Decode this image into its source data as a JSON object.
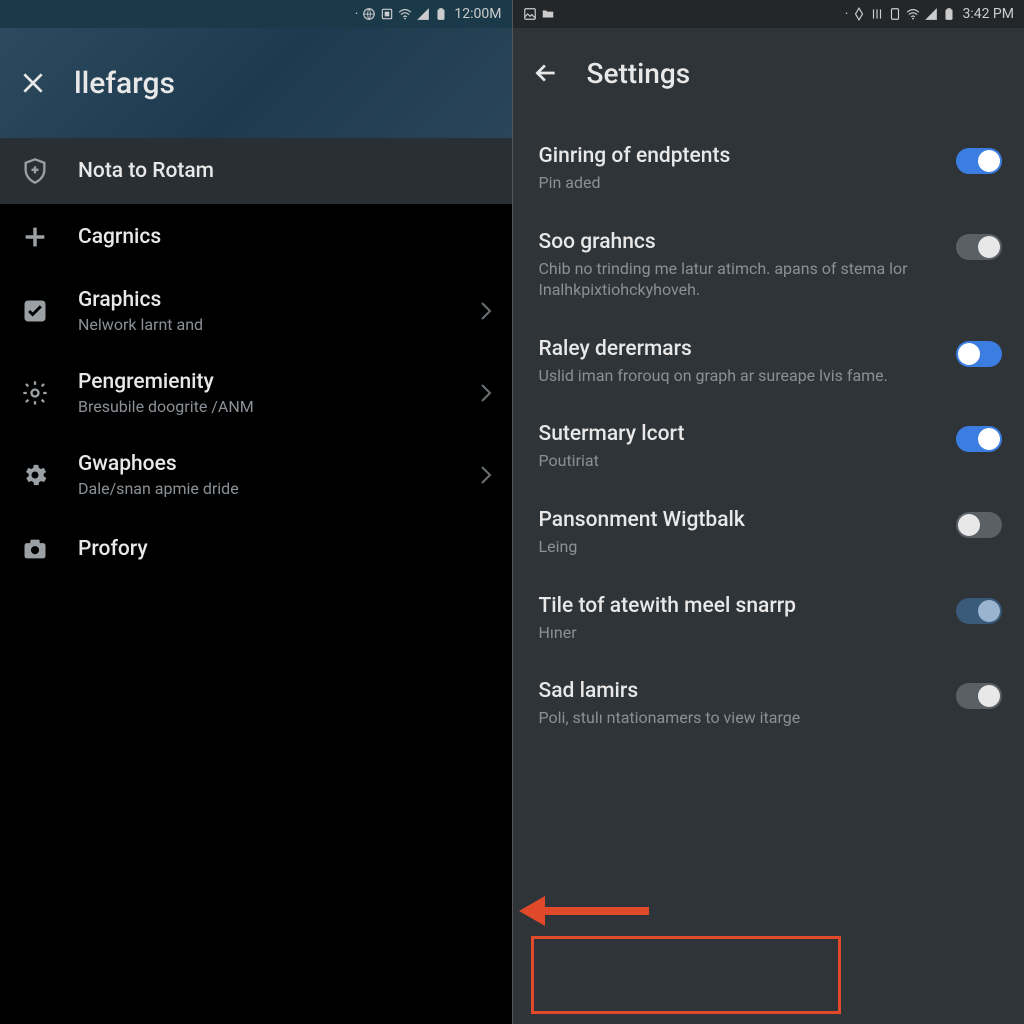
{
  "left": {
    "status": {
      "time": "12:00M"
    },
    "header": {
      "title": "llefargs"
    },
    "items": [
      {
        "title": "Nota to Rotam",
        "sub": "",
        "chevron": false,
        "highlighted": true,
        "icon": "shield-plus-icon"
      },
      {
        "title": "Cagrnics",
        "sub": "",
        "chevron": false,
        "highlighted": false,
        "icon": "plus-icon"
      },
      {
        "title": "Graphics",
        "sub": "Nelwork larnt and",
        "chevron": true,
        "highlighted": false,
        "icon": "check-box-icon"
      },
      {
        "title": "Pengremienity",
        "sub": "Bresubile doogrite /ANM",
        "chevron": true,
        "highlighted": false,
        "icon": "gear-outline-icon"
      },
      {
        "title": "Gwaphoes",
        "sub": "Dale/snan apmie dride",
        "chevron": true,
        "highlighted": false,
        "icon": "gear-icon"
      },
      {
        "title": "Profory",
        "sub": "",
        "chevron": false,
        "highlighted": false,
        "icon": "camera-icon"
      }
    ]
  },
  "right": {
    "status": {
      "time": "3:42 PM"
    },
    "header": {
      "title": "Settings"
    },
    "items": [
      {
        "title": "Ginring of endptents",
        "sub": "Pin aded",
        "state": "on"
      },
      {
        "title": "Soo grahncs",
        "sub": "Chib no trinding me latur atimch. apans of stema lor Inalhkpixtiohckyhoveh.",
        "state": "off"
      },
      {
        "title": "Raley derermars",
        "sub": "Uslid iman frorouq on graph ar sureape lvis fame.",
        "state": "on-left"
      },
      {
        "title": "Sutermary lcort",
        "sub": "Poutiriat",
        "state": "on"
      },
      {
        "title": "Pansonment Wigtbalk",
        "sub": "Leing",
        "state": "off-left"
      },
      {
        "title": "Tile tof atewith meel snarrp",
        "sub": "Hıner",
        "state": "dim"
      },
      {
        "title": "Sad lamirs",
        "sub": "Poli, stulı ntationamers to view itarge",
        "state": "off"
      }
    ]
  }
}
